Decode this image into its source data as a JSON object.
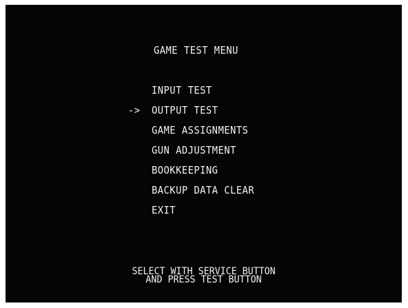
{
  "title": "GAME TEST MENU",
  "cursor": "->",
  "selected_index": 1,
  "menu": [
    {
      "label": "INPUT TEST"
    },
    {
      "label": "OUTPUT TEST"
    },
    {
      "label": "GAME ASSIGNMENTS"
    },
    {
      "label": "GUN ADJUSTMENT"
    },
    {
      "label": "BOOKKEEPING"
    },
    {
      "label": "BACKUP DATA CLEAR"
    },
    {
      "label": "EXIT"
    }
  ],
  "footer": {
    "line1": "SELECT WITH SERVICE BUTTON",
    "line2": "AND PRESS TEST BUTTON"
  },
  "colors": {
    "screen_bg": "#050505",
    "text": "#f2f2f2"
  }
}
